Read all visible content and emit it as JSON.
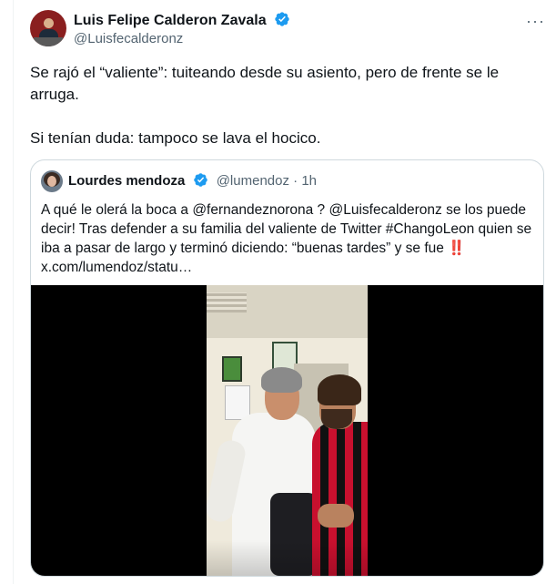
{
  "tweet": {
    "author_name": "Luis Felipe Calderon Zavala",
    "author_handle": "@Luisfecalderonz",
    "text_paragraph_1": "Se rajó el “valiente”: tuiteando desde su asiento, pero de frente se le arruga.",
    "text_paragraph_2": "Si tenían duda: tampoco se lava el hocico.",
    "more_icon": "···"
  },
  "quoted_tweet": {
    "author_name": "Lourdes mendoza",
    "author_handle": "@lumendoz",
    "separator": " · ",
    "time": "1h",
    "text": "A qué le  olerá la boca a @fernandeznorona ? @Luisfecalderonz se los puede decir! Tras defender a su familia del valiente de Twitter  #ChangoLeon  quien se iba a pasar de largo y terminó diciendo:  “buenas tardes” y se fue ‼️ x.com/lumendoz/statu…"
  },
  "colors": {
    "text_primary": "#0f1419",
    "text_secondary": "#536471",
    "verified_blue": "#1d9bf0",
    "border": "#cfd9de"
  }
}
